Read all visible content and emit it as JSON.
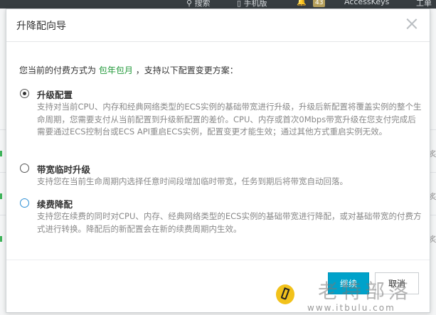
{
  "background": {
    "topbar": {
      "search_label": "搜索",
      "mobile_label": "手机版",
      "notification_count": "43",
      "accesskeys_label": "AccessKeys",
      "edge_label": "工单"
    },
    "edge_chars": [
      "炙",
      "炙",
      "炙"
    ]
  },
  "dialog": {
    "title": "升降配向导",
    "intro_prefix": "您当前的付费方式为",
    "billing_mode": "包年包月",
    "intro_suffix": "，支持以下配置变更方案：",
    "options": [
      {
        "title": "升级配置",
        "checked": true,
        "description": "支持对当前CPU、内存和经典网络类型的ECS实例的基础带宽进行升级，升级后新配置将覆盖实例的整个生命周期，您需要支付从当前配置到升级新配置的差价。CPU、内存或首次0Mbps带宽升级在您支付完成后需要通过ECS控制台或ECS API重启ECS实例，配置变更才能生效；通过其他方式重启实例无效。"
      },
      {
        "title": "带宽临时升级",
        "checked": false,
        "description": "支持您在当前生命周期内选择任意时间段增加临时带宽，任务到期后将带宽自动回落。"
      },
      {
        "title": "续费降配",
        "checked": false,
        "description": "支持您在续费的同时对CPU、内存、经典网络类型的ECS实例的基础带宽进行降配，或对基础带宽的付费方式进行转换。降配后的新配置会在新的续费周期内生效。"
      }
    ],
    "continue_label": "继续",
    "cancel_label": "取消"
  },
  "watermark": {
    "name": "老特部落",
    "url": "www.itbulu.com"
  },
  "colors": {
    "primary": "#00a2ca",
    "highlight": "#22993a",
    "topbar": "#373d41"
  }
}
